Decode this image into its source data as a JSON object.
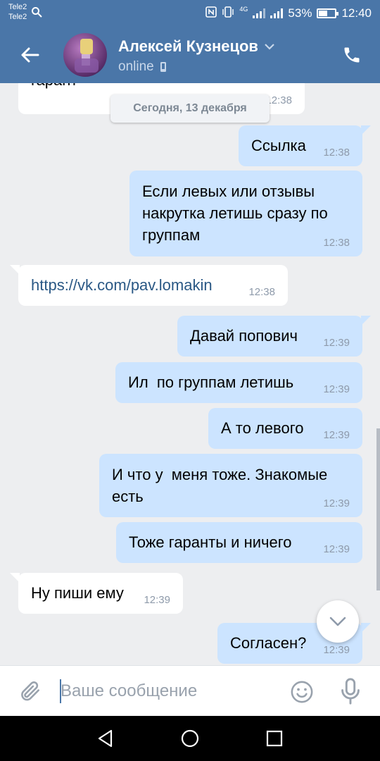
{
  "status_bar": {
    "carriers": [
      "Tele2",
      "Tele2"
    ],
    "network": "4G",
    "battery_percent": "53%",
    "battery_level": 0.53,
    "time": "12:40"
  },
  "header": {
    "contact_name": "Алексей Кузнецов",
    "status": "online"
  },
  "chat": {
    "date_separator": "Сегодня, 13 декабря",
    "partial_message": {
      "text": "гарант",
      "time": "12:38"
    },
    "messages": [
      {
        "dir": "out",
        "text": "Ссылка",
        "time": "12:38"
      },
      {
        "dir": "out",
        "text": "Если левых или отзывы накрутка летишь сразу по группам",
        "time": "12:38"
      },
      {
        "dir": "in",
        "text": "https://vk.com/pav.lomakin",
        "time": "12:38"
      },
      {
        "dir": "out",
        "text": "Давай попович",
        "time": "12:39"
      },
      {
        "dir": "out",
        "text": "Ил  по группам летишь",
        "time": "12:39"
      },
      {
        "dir": "out",
        "text": "А то левого",
        "time": "12:39"
      },
      {
        "dir": "out",
        "text": "И что у  меня тоже. Знакомые есть",
        "time": "12:39"
      },
      {
        "dir": "out",
        "text": "Тоже гаранты и ничего",
        "time": "12:39"
      },
      {
        "dir": "in",
        "text": "Ну пиши ему",
        "time": "12:39"
      },
      {
        "dir": "out",
        "text": "Согласен?",
        "time": "12:39"
      }
    ]
  },
  "composer": {
    "placeholder": "Ваше сообщение",
    "value": ""
  },
  "icons": {
    "back": "arrow-left-icon",
    "call": "phone-icon",
    "attach": "paperclip-icon",
    "emoji": "smiley-icon",
    "mic": "microphone-icon",
    "scroll_down": "chevron-down-icon",
    "nav": [
      "back-triangle-icon",
      "home-circle-icon",
      "recents-square-icon"
    ]
  },
  "colors": {
    "brand": "#4a76a8",
    "outgoing_bubble": "#cce4ff",
    "incoming_bubble": "#ffffff",
    "chat_background": "#edeef0",
    "link": "#2a5885"
  }
}
